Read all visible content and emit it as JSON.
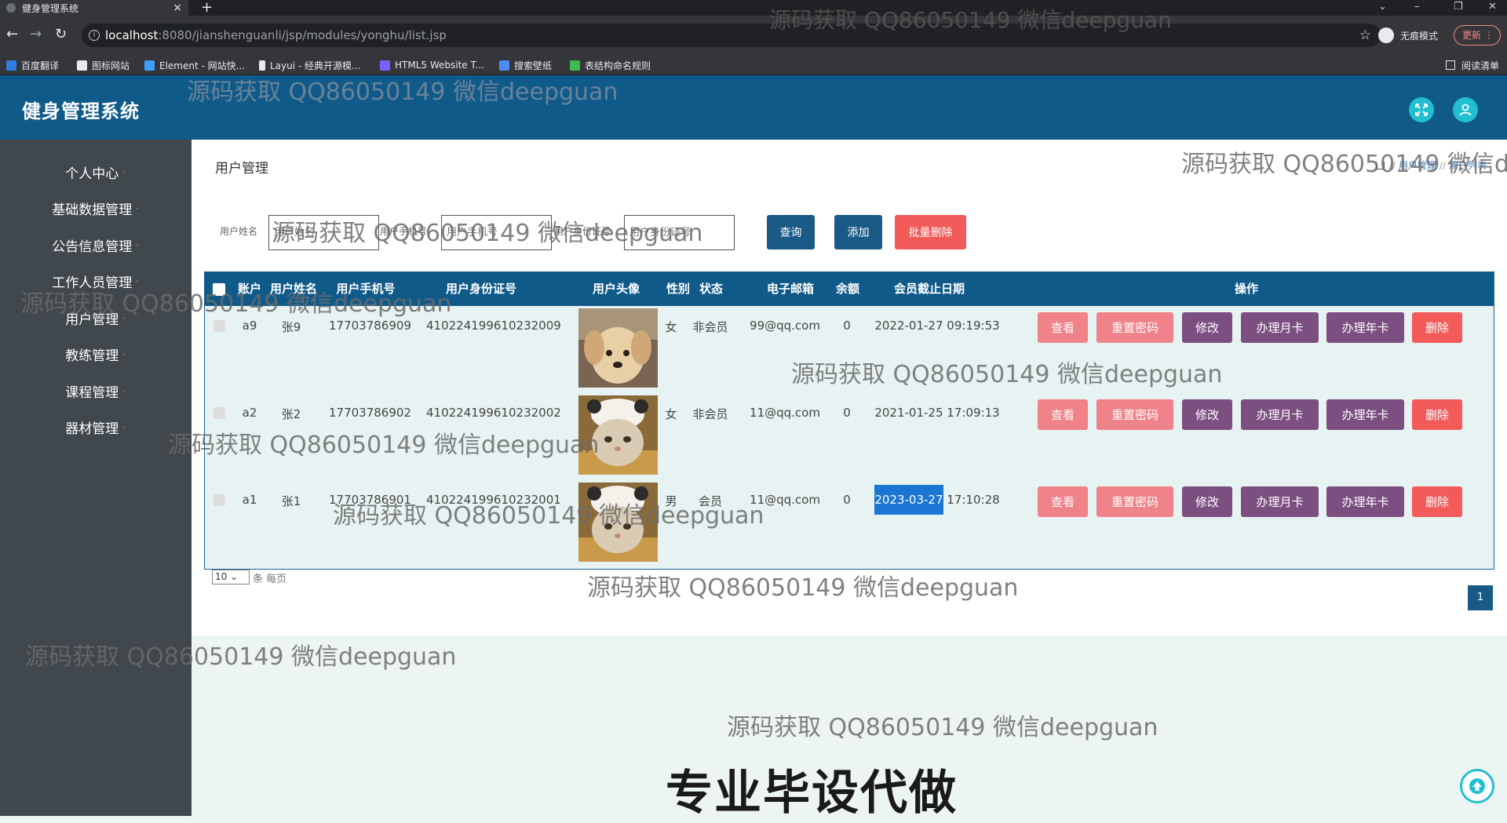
{
  "browser": {
    "tab_title": "健身管理系统",
    "new_tab": "+",
    "url_host": "localhost",
    "url_rest": ":8080/jianshenguanli/jsp/modules/yonghu/list.jsp",
    "incognito_label": "无痕模式",
    "update_label": "更新",
    "bookmarks": [
      "百度翻译",
      "图标网站",
      "Element - 网站快...",
      "Layui - 经典开源模...",
      "HTML5 Website T...",
      "搜索壁纸",
      "表结构命名规则"
    ],
    "reading_list": "阅读清单"
  },
  "app": {
    "title": "健身管理系统"
  },
  "sidebar": {
    "items": [
      "个人中心",
      "基础数据管理",
      "公告信息管理",
      "工作人员管理",
      "用户管理",
      "教练管理",
      "课程管理",
      "器材管理"
    ]
  },
  "page": {
    "title": "用户管理",
    "breadcrumb": [
      "用户管理",
      "用户列表"
    ]
  },
  "search": {
    "name_label": "用户姓名",
    "name_placeholder": "用户姓名",
    "phone_label": "用户手机号",
    "phone_placeholder": "用户手机号",
    "idcard_label": "用户身份证号",
    "idcard_placeholder": "用户身份证号",
    "query_label": "查询",
    "add_label": "添加",
    "batch_delete_label": "批量删除"
  },
  "table": {
    "headers": [
      "账户",
      "用户姓名",
      "用户手机号",
      "用户身份证号",
      "用户头像",
      "性别",
      "状态",
      "电子邮箱",
      "余额",
      "会员截止日期",
      "操作"
    ],
    "rows": [
      {
        "account": "a9",
        "name": "张9",
        "phone": "17703786909",
        "idcard": "410224199610232009",
        "gender": "女",
        "status": "非会员",
        "email": "99@qq.com",
        "balance": "0",
        "expiry_date": "2022-01-27",
        "expiry_time": "09:19:53"
      },
      {
        "account": "a2",
        "name": "张2",
        "phone": "17703786902",
        "idcard": "410224199610232002",
        "gender": "女",
        "status": "非会员",
        "email": "11@qq.com",
        "balance": "0",
        "expiry_date": "2021-01-25",
        "expiry_time": "17:09:13"
      },
      {
        "account": "a1",
        "name": "张1",
        "phone": "17703786901",
        "idcard": "410224199610232001",
        "gender": "男",
        "status": "会员",
        "email": "11@qq.com",
        "balance": "0",
        "expiry_date": "2023-03-27",
        "expiry_time": "17:10:28"
      }
    ],
    "actions": [
      "查看",
      "重置密码",
      "修改",
      "办理月卡",
      "办理年卡",
      "删除"
    ]
  },
  "pagination": {
    "page_size": "10",
    "page_size_suffix": "条 每页",
    "current_page": "1"
  },
  "watermarks": {
    "text": "源码获取 QQ86050149 微信deepguan",
    "clipped": "源码获取 QQ86050149 微信de"
  },
  "promo_text": "专业毕设代做",
  "colors": {
    "header": "#105a8a",
    "sidebar": "#40474d",
    "accent_cyan": "#22bfd1",
    "danger": "#f35a5a",
    "pink": "#f0828a",
    "purple": "#7c4f81"
  }
}
